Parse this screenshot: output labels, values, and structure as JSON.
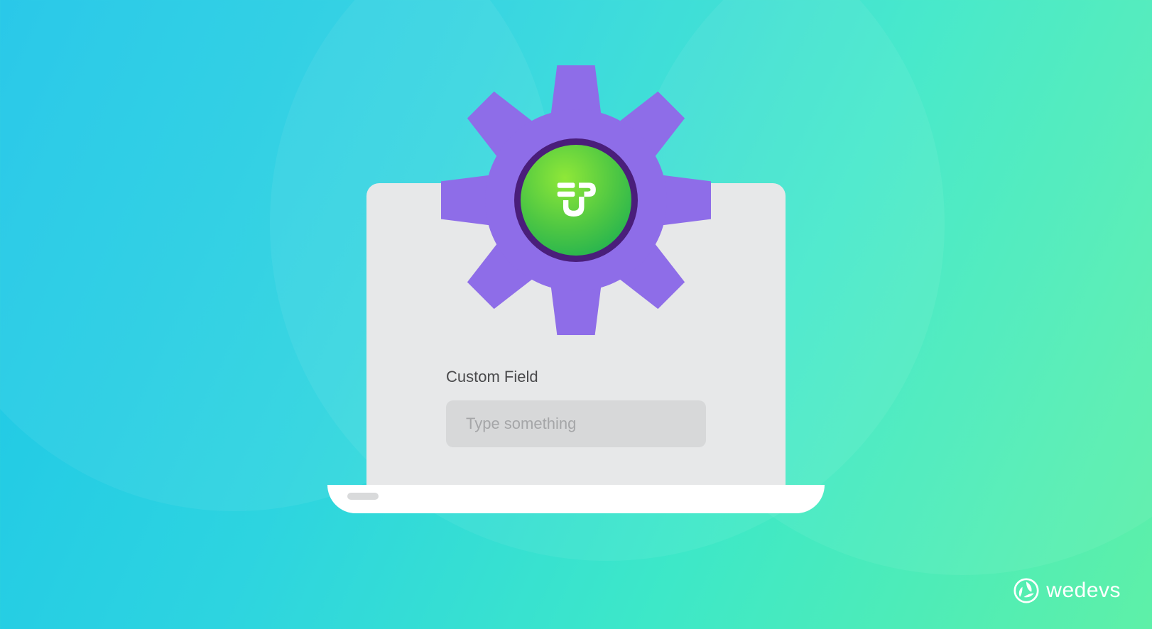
{
  "form": {
    "label": "Custom Field",
    "placeholder": "Type something"
  },
  "brand": {
    "name": "wedevs"
  },
  "icons": {
    "gear": "gear-icon",
    "logo": "up-logo-icon",
    "brand": "wedevs-logo-icon"
  }
}
